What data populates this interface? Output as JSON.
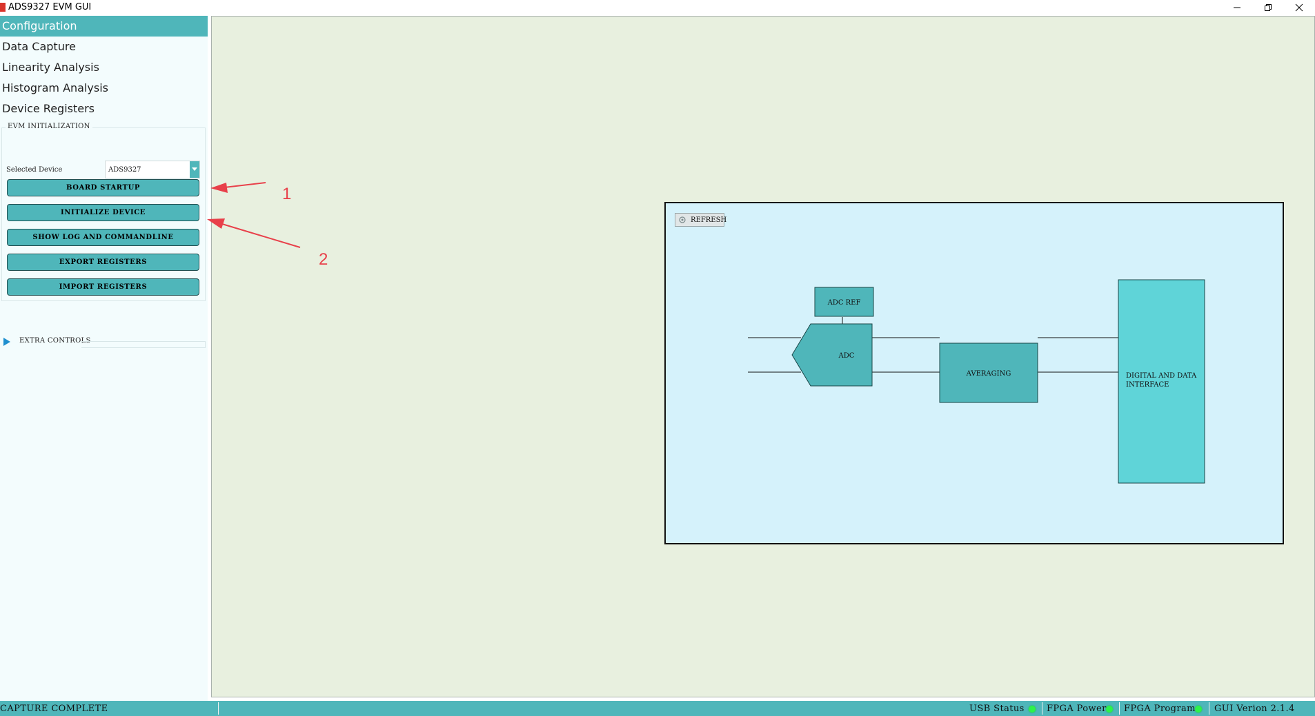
{
  "window": {
    "title": "ADS9327 EVM GUI"
  },
  "sidebar": {
    "nav_items": [
      {
        "label": "Configuration",
        "active": true
      },
      {
        "label": "Data Capture",
        "active": false
      },
      {
        "label": "Linearity Analysis",
        "active": false
      },
      {
        "label": "Histogram Analysis",
        "active": false
      },
      {
        "label": "Device Registers",
        "active": false
      }
    ],
    "evm_initialization": {
      "legend": "EVM INITIALIZATION",
      "selected_device_label": "Selected Device",
      "selected_device_value": "ADS9327",
      "buttons": [
        "BOARD STARTUP",
        "INITIALIZE DEVICE",
        "SHOW LOG AND COMMANDLINE",
        "EXPORT REGISTERS",
        "IMPORT REGISTERS"
      ]
    },
    "extra_controls_label": "EXTRA CONTROLS"
  },
  "diagram": {
    "refresh_label": "REFRESH",
    "blocks": {
      "adc_ref": "ADC REF",
      "adc": "ADC",
      "averaging": "AVERAGING",
      "digital_line1": "DIGITAL AND DATA",
      "digital_line2": "INTERFACE"
    }
  },
  "annotations": {
    "marker_1": "1",
    "marker_2": "2"
  },
  "statusbar": {
    "status_text": "CAPTURE COMPLETE",
    "usb_status": "USB Status",
    "fpga_power": "FPGA Power",
    "fpga_program": "FPGA Program",
    "gui_version": "GUI Verion 2.1.4"
  },
  "colors": {
    "accent": "#4fb6ba",
    "diagram_bg": "#d5f2fb",
    "main_bg": "#e8f0df",
    "led_on": "#2ef24a",
    "annotation_red": "#e8404a"
  }
}
